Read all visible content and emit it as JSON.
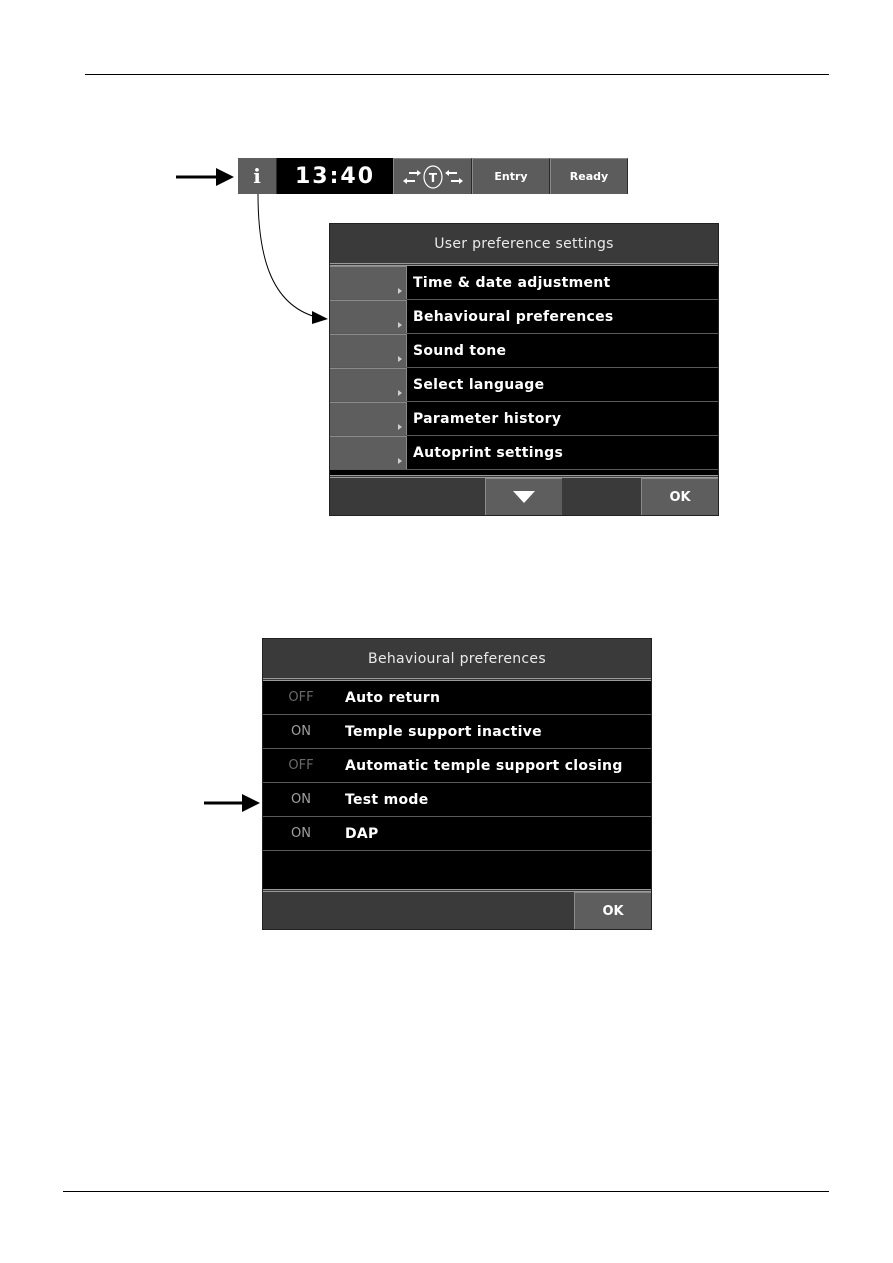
{
  "status_bar": {
    "info_icon": "info-icon",
    "time": "13:40",
    "mode_icon": "transfer-t-icon",
    "entry_label": "Entry",
    "ready_label": "Ready"
  },
  "user_preferences": {
    "title": "User preference settings",
    "items": [
      {
        "label": "Time & date adjustment"
      },
      {
        "label": "Behavioural preferences"
      },
      {
        "label": "Sound tone"
      },
      {
        "label": "Select language"
      },
      {
        "label": "Parameter history"
      },
      {
        "label": "Autoprint settings"
      }
    ],
    "scroll_down_icon": "triangle-down-icon",
    "ok_label": "OK"
  },
  "behavioural_preferences": {
    "title": "Behavioural preferences",
    "items": [
      {
        "state": "OFF",
        "label": "Auto return"
      },
      {
        "state": "ON",
        "label": "Temple support inactive"
      },
      {
        "state": "OFF",
        "label": "Automatic temple support closing"
      },
      {
        "state": "ON",
        "label": "Test mode"
      },
      {
        "state": "ON",
        "label": "DAP"
      }
    ],
    "ok_label": "OK"
  }
}
